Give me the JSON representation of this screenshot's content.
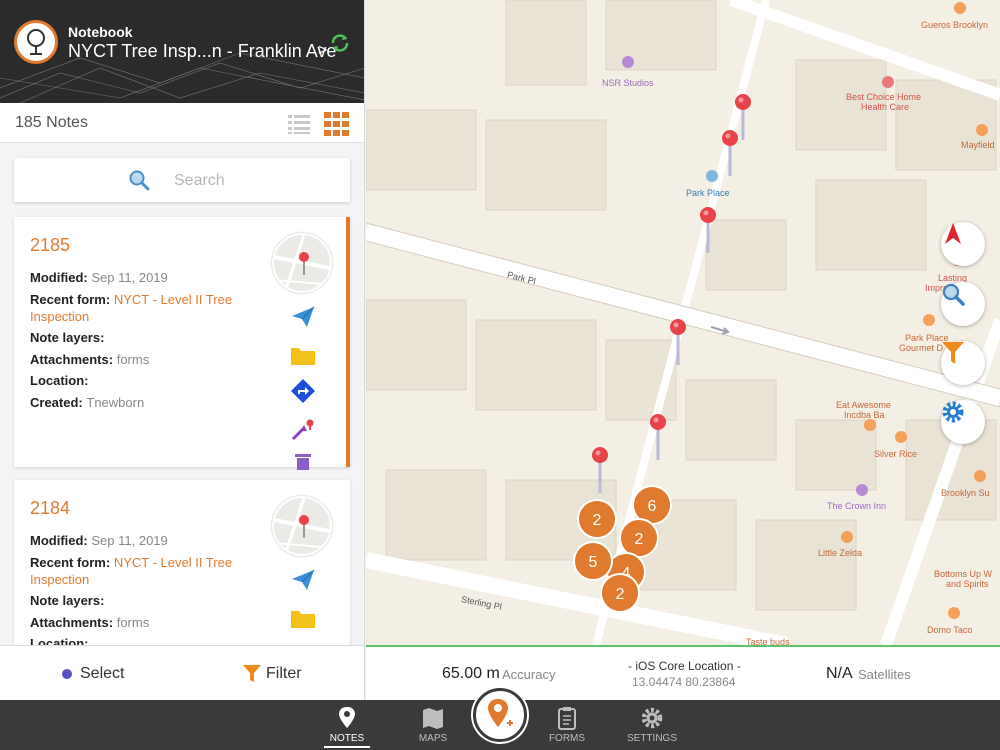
{
  "header": {
    "label": "Notebook",
    "title": "NYCT Tree Insp...n - Franklin Ave",
    "chevron": ">"
  },
  "notes_bar": {
    "count": "185 Notes"
  },
  "search": {
    "placeholder": "Search"
  },
  "cards": [
    {
      "number": "2185",
      "modified_label": "Modified:",
      "modified": "Sep 11, 2019",
      "recent_label": "Recent form:",
      "recent_1": "NYCT - Level II Tree",
      "recent_2": "Inspection",
      "layers_label": "Note layers:",
      "attach_label": "Attachments:",
      "attach": "forms",
      "location_label": "Location:",
      "created_label": "Created:",
      "created": "Tnewborn"
    },
    {
      "number": "2184",
      "modified_label": "Modified:",
      "modified": "Sep 11, 2019",
      "recent_label": "Recent form:",
      "recent_1": "NYCT - Level II Tree",
      "recent_2": "Inspection",
      "layers_label": "Note layers:",
      "attach_label": "Attachments:",
      "attach": "forms",
      "location_label": "Location:"
    }
  ],
  "bottom_left": {
    "select": "Select",
    "filter": "Filter"
  },
  "map": {
    "streets": [
      "Park Pl",
      "Sterling Pl"
    ],
    "places": [
      {
        "name": "Gueros Brooklyn",
        "color": "#c5683c"
      },
      {
        "name": "NSR Studios",
        "color": "#9a6cbf"
      },
      {
        "name": "Best Choice Home",
        "color": "#d4544b"
      },
      {
        "name": "Health Care",
        "color": "#d4544b"
      },
      {
        "name": "Mayfield",
        "color": "#c5683c"
      },
      {
        "name": "Park Place",
        "color": "#2d7fb5"
      },
      {
        "name": "Lasting",
        "color": "#d4544b"
      },
      {
        "name": "Impressions",
        "color": "#d4544b"
      },
      {
        "name": "Park Place",
        "color": "#c5683c"
      },
      {
        "name": "Gourmet D",
        "color": "#c5683c"
      },
      {
        "name": "Eat Awesome",
        "color": "#c5683c"
      },
      {
        "name": "Incdba Ba",
        "color": "#c5683c"
      },
      {
        "name": "Silver Rice",
        "color": "#c5683c"
      },
      {
        "name": "The Crown Inn",
        "color": "#9a6cbf"
      },
      {
        "name": "Brooklyn Su",
        "color": "#c5683c"
      },
      {
        "name": "Little Zelda",
        "color": "#c5683c"
      },
      {
        "name": "Bottoms Up W",
        "color": "#c5683c"
      },
      {
        "name": "and Spirits",
        "color": "#c5683c"
      },
      {
        "name": "Domo Taco",
        "color": "#c5683c"
      },
      {
        "name": "Taste buds",
        "color": "#c5683c"
      }
    ],
    "clusters": [
      "6",
      "2",
      "2",
      "5",
      "4",
      "2"
    ]
  },
  "gps": {
    "accuracy_value": "65.00 m",
    "accuracy_label": "Accuracy",
    "location_title": "- iOS Core Location -",
    "coords": "13.04474 80.23864",
    "satellites_value": "N/A",
    "satellites_label": "Satellites"
  },
  "tabs": [
    {
      "label": "NOTES",
      "icon": "pin-icon"
    },
    {
      "label": "MAPS",
      "icon": "map-icon"
    },
    {
      "label": "FORMS",
      "icon": "clipboard-icon"
    },
    {
      "label": "SETTINGS",
      "icon": "gear-icon"
    }
  ],
  "colors": {
    "accent": "#e07a2f",
    "pin": "#e8434b",
    "gps_ok": "#5cc46a",
    "tabbar": "#3a3a3a"
  }
}
